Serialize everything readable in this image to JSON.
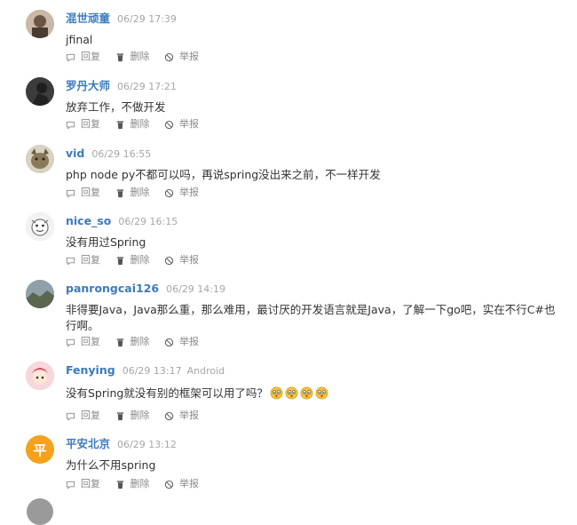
{
  "action_labels": {
    "reply": "回复",
    "delete": "删除",
    "report": "举报"
  },
  "icons": {
    "reply": "comment-icon",
    "delete": "trash-icon",
    "report": "ban-icon",
    "emoji": "surprised-emoji-icon"
  },
  "colors": {
    "username": "#3b7bbf",
    "meta": "#a6a6a6",
    "text": "#333333",
    "avatar_orange": "#f4a11c"
  },
  "comments": [
    {
      "user": "混世顽童",
      "time": "06/29 17:39",
      "text": "jfinal"
    },
    {
      "user": "罗丹大师",
      "time": "06/29 17:21",
      "text": "放弃工作，不做开发"
    },
    {
      "user": "vid",
      "time": "06/29 16:55",
      "text": "php node py不都可以吗，再说spring没出来之前，不一样开发"
    },
    {
      "user": "nice_so",
      "time": "06/29 16:15",
      "text": "没有用过Spring"
    },
    {
      "user": "panrongcai126",
      "time": "06/29 14:19",
      "text": "非得要Java，Java那么重，那么难用，最讨厌的开发语言就是Java，了解一下go吧，实在不行C#也行啊。"
    },
    {
      "user": "Fenying",
      "time": "06/29 13:17",
      "device": "Android",
      "text": "没有Spring就没有别的框架可以用了吗？",
      "emoji_count": 4
    },
    {
      "user": "平安北京",
      "time": "06/29 13:12",
      "text": "为什么不用spring",
      "avatar_text": "平"
    }
  ]
}
